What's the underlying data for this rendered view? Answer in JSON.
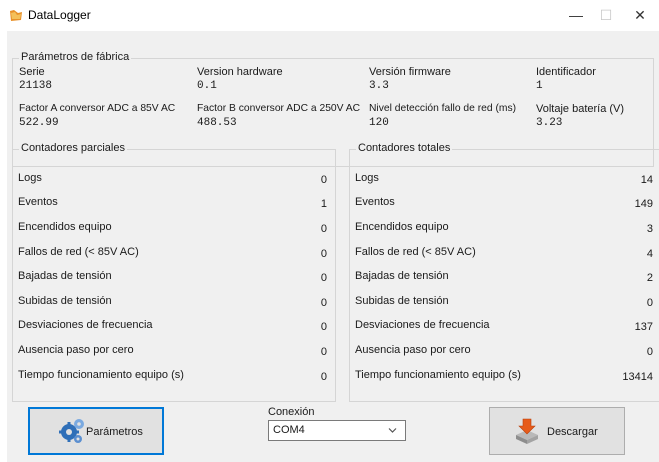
{
  "window": {
    "title": "DataLogger",
    "minimize": "—",
    "maximize": "☐",
    "close": "✕"
  },
  "factory": {
    "title": "Parámetros de fábrica",
    "fields": [
      {
        "label": "Serie",
        "value": "21138"
      },
      {
        "label": "Version hardware",
        "value": "0.1"
      },
      {
        "label": "Versión firmware",
        "value": "3.3"
      },
      {
        "label": "Identificador",
        "value": "1"
      },
      {
        "label": "Factor A conversor ADC a 85V AC",
        "value": "522.99"
      },
      {
        "label": "Factor B conversor ADC a 250V AC",
        "value": "488.53"
      },
      {
        "label": "Nivel detección fallo de red (ms)",
        "value": "120"
      },
      {
        "label": "Voltaje batería (V)",
        "value": "3.23"
      }
    ]
  },
  "partial": {
    "title": "Contadores parciales",
    "rows": [
      {
        "label": "Logs",
        "value": "0"
      },
      {
        "label": "Eventos",
        "value": "1"
      },
      {
        "label": "Encendidos equipo",
        "value": "0"
      },
      {
        "label": "Fallos de red (< 85V AC)",
        "value": "0"
      },
      {
        "label": "Bajadas de tensión",
        "value": "0"
      },
      {
        "label": "Subidas de tensión",
        "value": "0"
      },
      {
        "label": "Desviaciones de frecuencia",
        "value": "0"
      },
      {
        "label": "Ausencia paso por cero",
        "value": "0"
      },
      {
        "label": "Tiempo funcionamiento equipo (s)",
        "value": "0"
      }
    ]
  },
  "total": {
    "title": "Contadores totales",
    "rows": [
      {
        "label": "Logs",
        "value": "14"
      },
      {
        "label": "Eventos",
        "value": "149"
      },
      {
        "label": "Encendidos equipo",
        "value": "3"
      },
      {
        "label": "Fallos de red (< 85V AC)",
        "value": "4"
      },
      {
        "label": "Bajadas de tensión",
        "value": "2"
      },
      {
        "label": "Subidas de tensión",
        "value": "0"
      },
      {
        "label": "Desviaciones de frecuencia",
        "value": "137"
      },
      {
        "label": "Ausencia paso por cero",
        "value": "0"
      },
      {
        "label": "Tiempo funcionamiento equipo (s)",
        "value": "13414"
      }
    ]
  },
  "footer": {
    "parametros_label": "Parámetros",
    "conexion_label": "Conexión",
    "conexion_value": "COM4",
    "descargar_label": "Descargar"
  },
  "icons": {
    "app": "datalogger-app-icon",
    "parametros": "gears-icon",
    "descargar": "download-icon",
    "dropdown": "chevron-down-icon"
  },
  "colors": {
    "focus_border": "#0078d7",
    "client_bg": "#f0f0f0"
  }
}
